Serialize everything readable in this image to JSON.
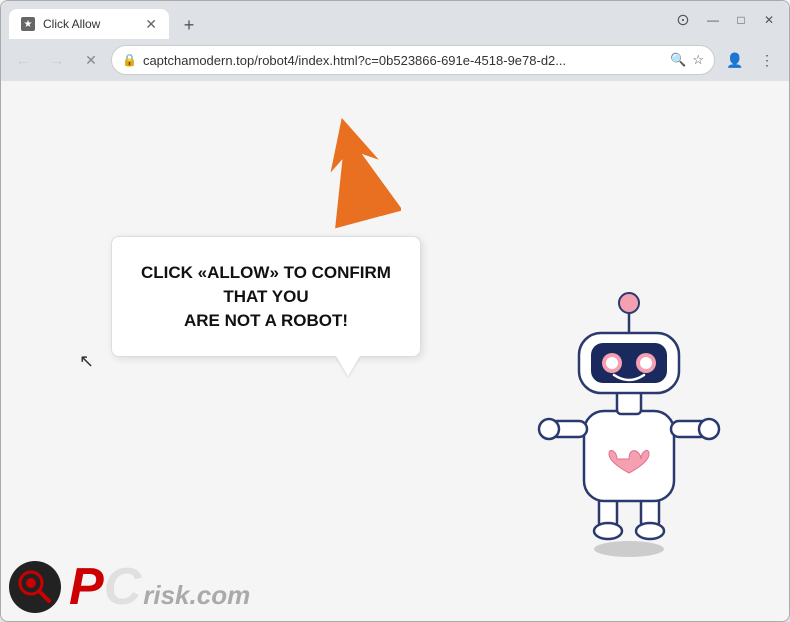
{
  "browser": {
    "tab": {
      "title": "Click Allow",
      "favicon": "★"
    },
    "new_tab_label": "+",
    "controls": {
      "minimize": "—",
      "maximize": "□",
      "close": "✕"
    },
    "nav": {
      "back": "←",
      "forward": "→",
      "reload": "✕",
      "url": "captchamodern.top/robot4/index.html?c=0b523866-691e-4518-9e78-d2...",
      "lock_icon": "🔒"
    },
    "icons": {
      "search": "🔍",
      "star": "☆",
      "profile": "👤",
      "menu": "⋮"
    }
  },
  "page": {
    "speech_bubble": {
      "line1": "CLICK «ALLOW» TO CONFIRM THAT YOU",
      "line2": "ARE NOT A ROBOT!"
    },
    "watermark": {
      "pc": "PC",
      "risk": "risk.com"
    }
  }
}
